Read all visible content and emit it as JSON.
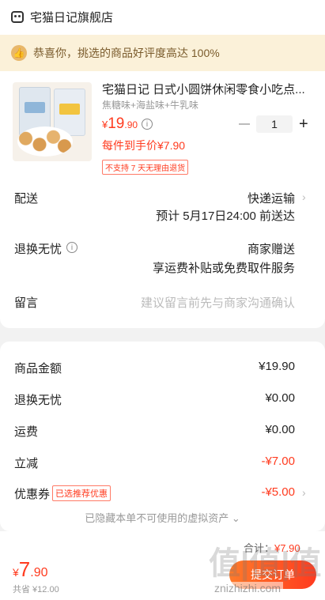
{
  "store": {
    "name": "宅猫日记旗舰店",
    "icon": "store-icon"
  },
  "banner": {
    "text": "恭喜你，挑选的商品好评度高达 100%",
    "icon": "thumbs-up-icon"
  },
  "product": {
    "title": "宅猫日记  日式小圆饼休闲零食小吃点...",
    "spec": "焦糖味+海盐味+牛乳味",
    "price_symbol": "¥",
    "price_int": "19",
    "price_dec": ".90",
    "quantity": "1",
    "per_unit": "每件到手价¥7.90",
    "no_return_badge": "不支持 7 天无理由退货"
  },
  "delivery": {
    "label": "配送",
    "method": "快递运输",
    "eta": "预计 5月17日24:00 前送达"
  },
  "return_service": {
    "label": "退换无忧",
    "value": "商家赠送",
    "detail": "享运费补贴或免费取件服务"
  },
  "message": {
    "label": "留言",
    "placeholder": "建议留言前先与商家沟通确认"
  },
  "summary": {
    "goods_label": "商品金额",
    "goods_value": "¥19.90",
    "return_label": "退换无忧",
    "return_value": "¥0.00",
    "shipping_label": "运费",
    "shipping_value": "¥0.00",
    "discount_label": "立减",
    "discount_value": "-¥7.00",
    "coupon_label": "优惠券",
    "coupon_tag": "已选推荐优惠",
    "coupon_value": "-¥5.00",
    "hidden_note": "已隐藏本单不可使用的虚拟资产 ⌄"
  },
  "footer": {
    "price_symbol": "¥",
    "price_int": "7",
    "price_dec": ".90",
    "saved": "共省 ¥12.00",
    "total_label": "合计：",
    "total_value": "¥7.90",
    "submit_label": "提交订单"
  },
  "watermark": {
    "logo": "值|值|值",
    "site": "znizhizhi.com"
  },
  "colors": {
    "accent": "#ff3b1f",
    "banner_bg": "#fbf1d9",
    "banner_text": "#7a5b2c"
  }
}
